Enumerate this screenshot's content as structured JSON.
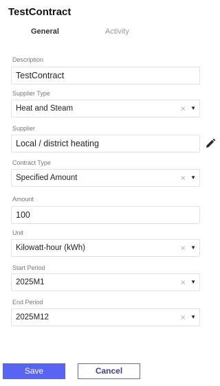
{
  "title": "TestContract",
  "tabs": {
    "general": "General",
    "activity": "Activity"
  },
  "fields": {
    "description": {
      "label": "Description",
      "value": "TestContract"
    },
    "supplier_type": {
      "label": "Supplier Type",
      "value": "Heat and Steam"
    },
    "supplier": {
      "label": "Supplier",
      "value": "Local / district heating"
    },
    "contract_type": {
      "label": "Contract Type",
      "value": "Specified Amount"
    },
    "amount": {
      "label": "Amount",
      "value": "100"
    },
    "unit": {
      "label": "Unit",
      "value": "Kilowatt-hour (kWh)"
    },
    "start_period": {
      "label": "Start Period",
      "value": "2025M1"
    },
    "end_period": {
      "label": "End Period",
      "value": "2025M12"
    }
  },
  "icons": {
    "clear": "×",
    "caret": "▼",
    "edit": "pencil-icon"
  },
  "buttons": {
    "save": "Save",
    "cancel": "Cancel"
  },
  "colors": {
    "accent": "#5865f2"
  }
}
